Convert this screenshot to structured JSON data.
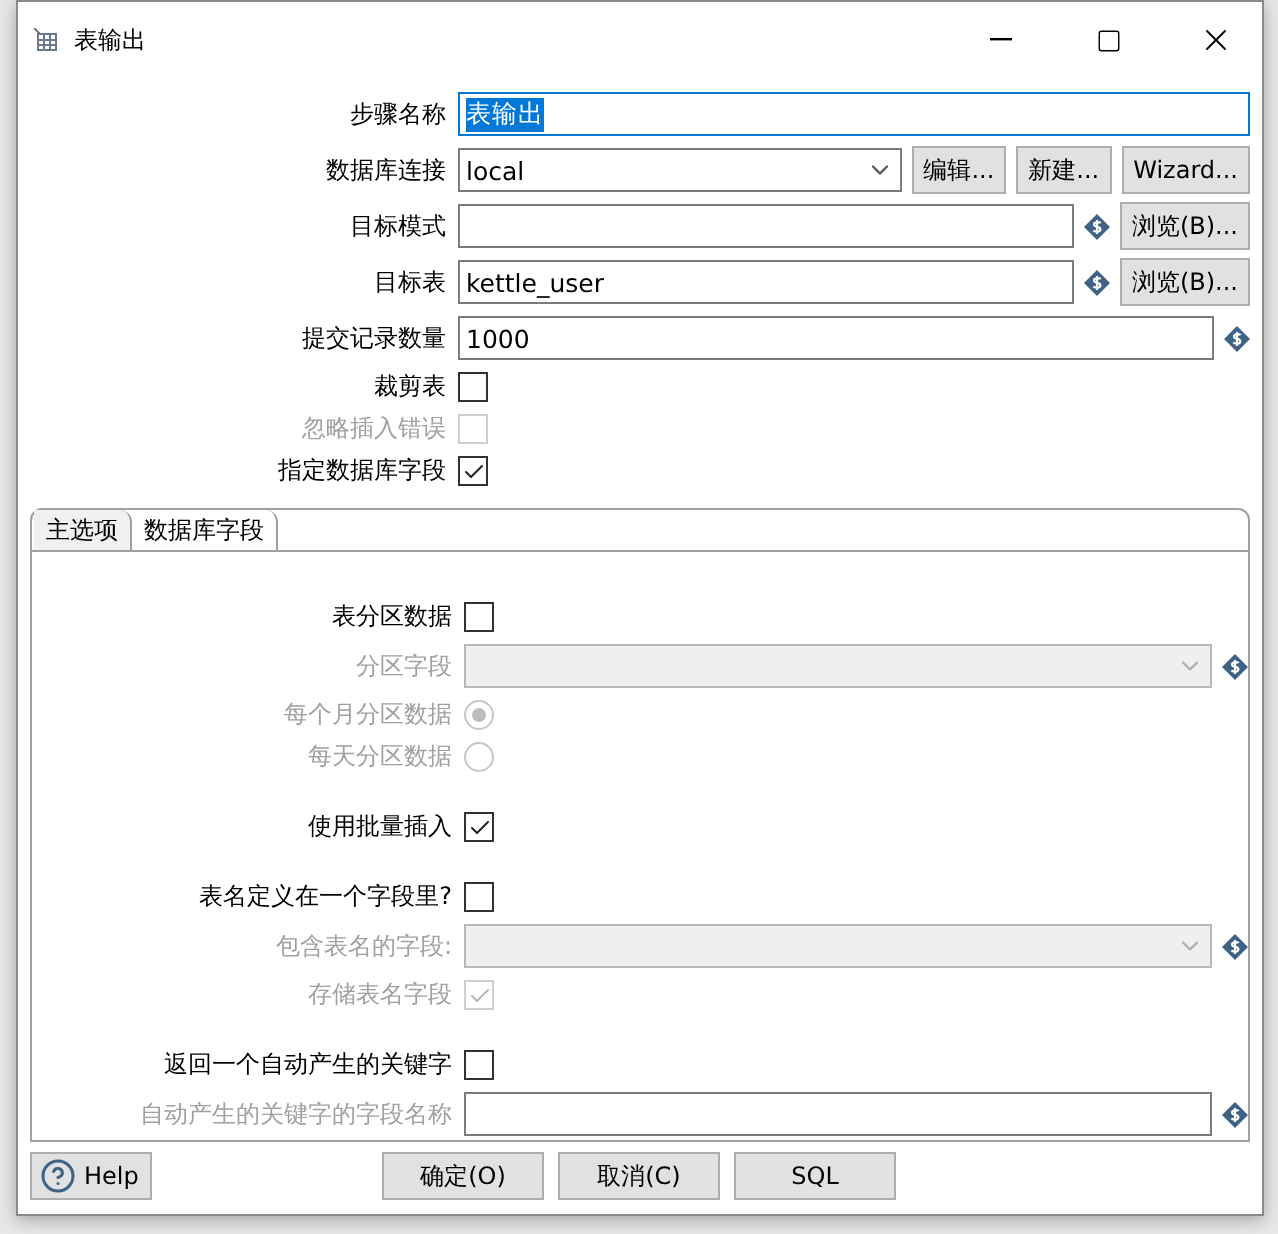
{
  "window": {
    "title": "表输出"
  },
  "fields": [
    {
      "kind": "text",
      "label": "步骤名称",
      "value": "表输出",
      "highlighted": true,
      "disabled": false
    },
    {
      "kind": "combo",
      "label": "数据库连接",
      "value": "local",
      "buttons": [
        "编辑...",
        "新建...",
        "Wizard..."
      ],
      "disabled": false
    },
    {
      "kind": "text",
      "label": "目标模式",
      "variable": true,
      "buttons": [
        "浏览(B)..."
      ],
      "disabled": false
    },
    {
      "kind": "text",
      "label": "目标表",
      "value": "kettle_user",
      "variable": true,
      "buttons": [
        "浏览(B)..."
      ],
      "disabled": false
    },
    {
      "kind": "text",
      "label": "提交记录数量",
      "value": "1000",
      "variable": true,
      "disabled": false
    },
    {
      "kind": "checkbox",
      "label": "裁剪表",
      "checked": false,
      "disabled": false
    },
    {
      "kind": "checkbox",
      "label": "忽略插入错误",
      "checked": false,
      "disabled": true
    },
    {
      "kind": "checkbox",
      "label": "指定数据库字段",
      "checked": true,
      "disabled": false
    }
  ],
  "tabs": [
    {
      "label": "主选项",
      "selected": true
    },
    {
      "label": "数据库字段",
      "selected": false
    }
  ],
  "panel_groups": [
    [
      {
        "kind": "checkbox",
        "label": "表分区数据",
        "checked": false,
        "disabled": false
      },
      {
        "kind": "combo",
        "label": "分区字段",
        "variable": true,
        "disabled": true
      },
      {
        "kind": "radio",
        "label": "每个月分区数据",
        "selected": true,
        "disabled": true
      },
      {
        "kind": "radio",
        "label": "每天分区数据",
        "selected": false,
        "disabled": true
      }
    ],
    [
      {
        "kind": "checkbox",
        "label": "使用批量插入",
        "checked": true,
        "disabled": false
      }
    ],
    [
      {
        "kind": "checkbox",
        "label": "表名定义在一个字段里?",
        "checked": false,
        "disabled": false
      },
      {
        "kind": "combo",
        "label": "包含表名的字段:",
        "variable": true,
        "disabled": true
      },
      {
        "kind": "checkbox",
        "label": "存储表名字段",
        "checked": true,
        "disabled": true
      }
    ],
    [
      {
        "kind": "checkbox",
        "label": "返回一个自动产生的关键字",
        "checked": false,
        "disabled": false
      },
      {
        "kind": "text",
        "label": "自动产生的关键字的字段名称",
        "variable": true,
        "disabled": true
      }
    ]
  ],
  "help_button": "Help",
  "buttons": [
    "确定(O)",
    "取消(C)",
    "SQL"
  ]
}
